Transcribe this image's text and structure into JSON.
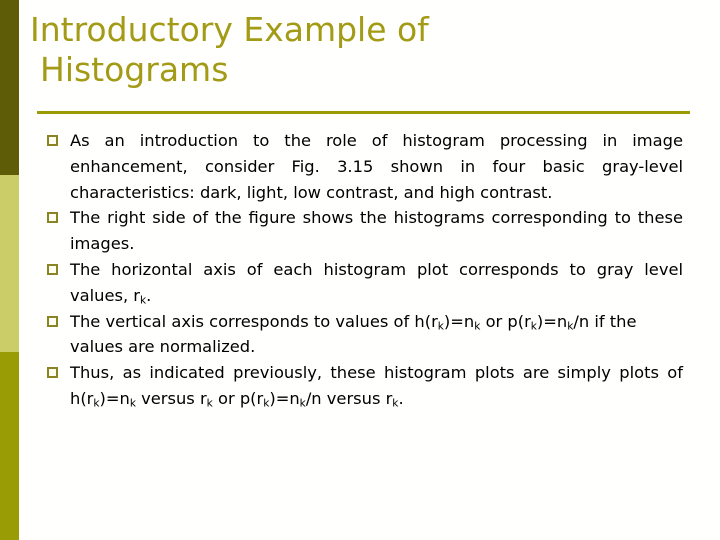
{
  "slide": {
    "title_line1": "Introductory Example of",
    "title_line2": "Histograms",
    "title_color": "#a39a16",
    "rule_color": "#9a9c06",
    "background_color": "#ffffff",
    "body_text_color": "#000000",
    "bullet_marker": "hollow-square",
    "bullet_marker_color": "#8a8522"
  },
  "sidebar": {
    "segments": [
      {
        "name": "top",
        "color": "#5e5c06"
      },
      {
        "name": "middle",
        "color": "#cbcd68"
      },
      {
        "name": "bottom",
        "color": "#9a9c06"
      }
    ]
  },
  "bullets": [
    {
      "id": "bullet-intro",
      "text": "As an introduction to the role of histogram processing in image enhancement, consider Fig. 3.15 shown in four basic gray-level characteristics: dark, light, low contrast, and high contrast."
    },
    {
      "id": "bullet-right-side",
      "text": "The right side of the figure shows the histograms corresponding to these images."
    },
    {
      "id": "bullet-horizontal-axis",
      "prefix": "The horizontal axis of each histogram plot corresponds to gray level values, r",
      "sub1": "k",
      "suffix": "."
    },
    {
      "id": "bullet-vertical-axis",
      "part1": "The vertical axis corresponds to values of h(r",
      "sub1": "k",
      "part2": ")=n",
      "sub2": "k",
      "part3": " or p(r",
      "sub3": "k",
      "part4": ")=n",
      "sub4": "k",
      "part5": "/n if the",
      "part6": "values are normalized."
    },
    {
      "id": "bullet-thus",
      "part1": "Thus, as indicated previously, these histogram plots are simply plots of h(r",
      "sub1": "k",
      "part2": ")=n",
      "sub2": "k",
      "part3": " versus r",
      "sub3": "k",
      "part4": " or p(r",
      "sub4": "k",
      "part5": ")=n",
      "sub5": "k",
      "part6": "/n versus r",
      "sub6": "k",
      "part7": "."
    }
  ]
}
